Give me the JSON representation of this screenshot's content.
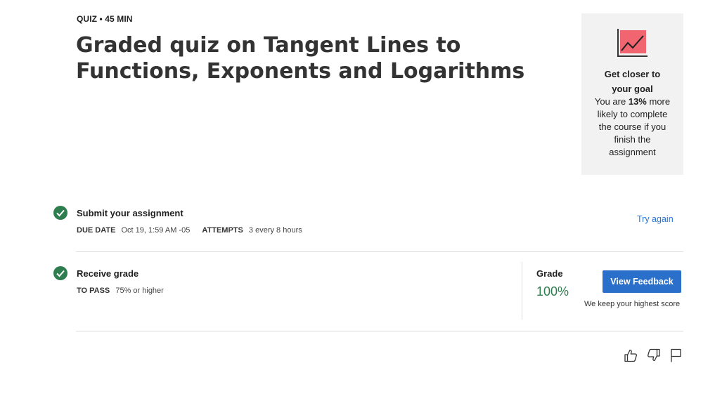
{
  "header": {
    "type_label": "QUIZ",
    "separator": "•",
    "duration": "45 MIN",
    "title": "Graded quiz on Tangent Lines to Functions, Exponents and Logarithms"
  },
  "goal_card": {
    "icon": "trend-chart-icon",
    "heading": "Get closer to your goal",
    "text_before": "You are",
    "percent": "13%",
    "text_after": "more likely to complete the course if you finish the assignment"
  },
  "steps": {
    "submit": {
      "title": "Submit your assignment",
      "due_label": "DUE DATE",
      "due_value": "Oct 19, 1:59 AM -05",
      "attempts_label": "ATTEMPTS",
      "attempts_value": "3 every 8 hours",
      "action_label": "Try again"
    },
    "grade": {
      "title": "Receive grade",
      "pass_label": "TO PASS",
      "pass_value": "75% or higher",
      "grade_label": "Grade",
      "grade_value": "100%",
      "feedback_button": "View Feedback",
      "note": "We keep your highest score"
    }
  },
  "footer": {
    "icons": [
      "thumbs-up-icon",
      "thumbs-down-icon",
      "flag-icon"
    ]
  },
  "colors": {
    "accent_blue": "#2a6fc9",
    "success_green": "#2e7d4f",
    "card_bg": "#f2f2f2",
    "chart_fill": "#f0656f"
  }
}
